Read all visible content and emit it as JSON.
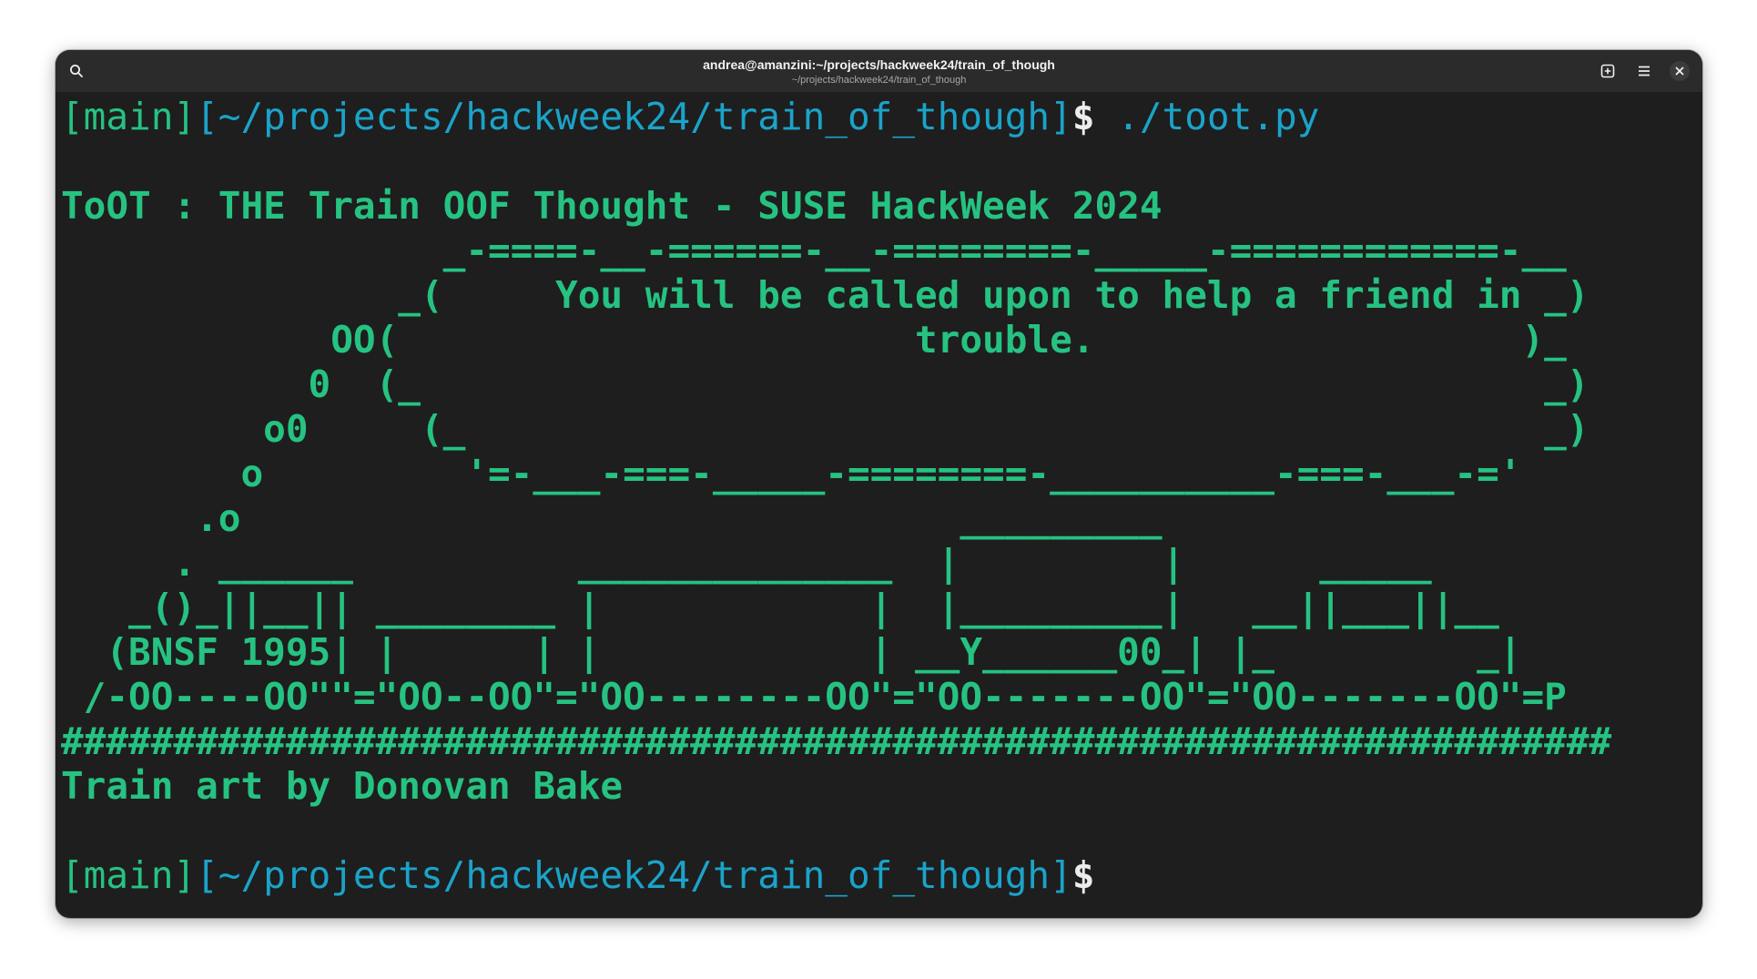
{
  "window": {
    "title": "andrea@amanzini:~/projects/hackweek24/train_of_though",
    "subtitle": "~/projects/hackweek24/train_of_though",
    "icons": {
      "search": "search-icon",
      "new_tab": "new-tab-icon",
      "menu": "hamburger-menu-icon",
      "close": "close-icon"
    }
  },
  "colors": {
    "background": "#1e1e1e",
    "titlebar": "#2b2b2b",
    "prompt_green": "#26c281",
    "prompt_blue": "#1ba3c9",
    "art_green": "#26c281"
  },
  "terminal": {
    "prompt1": {
      "branch": "[main]",
      "path": "[~/projects/hackweek24/train_of_though]",
      "symbol": "$",
      "command": " ./toot.py"
    },
    "banner": "ToOT : THE Train OOF Thought - SUSE HackWeek 2024",
    "art_lines": [
      "                 _-====-__-======-__-========-_____-============-__",
      "               _(     You will be called upon to help a friend in _)",
      "            OO(                       trouble.                   )_",
      "           0  (_                                                  _)",
      "         o0     (_                                                _)",
      "        o         '=-___-===-_____-========-__________-===-___-='",
      "      .o                                _________",
      "     . ______          ______________  |         |      _____",
      "   _()_||__|| ________ |            |  |_________|   __||___||__",
      "  (BNSF 1995| |      | |            | __Y______00_| |_         _|",
      " /-OO----OO\"\"=\"OO--OO\"=\"OO--------OO\"=\"OO-------OO\"=\"OO-------OO\"=P",
      "#####################################################################"
    ],
    "credit": "Train art by Donovan Bake",
    "prompt2": {
      "branch": "[main]",
      "path": "[~/projects/hackweek24/train_of_though]",
      "symbol": "$"
    }
  }
}
